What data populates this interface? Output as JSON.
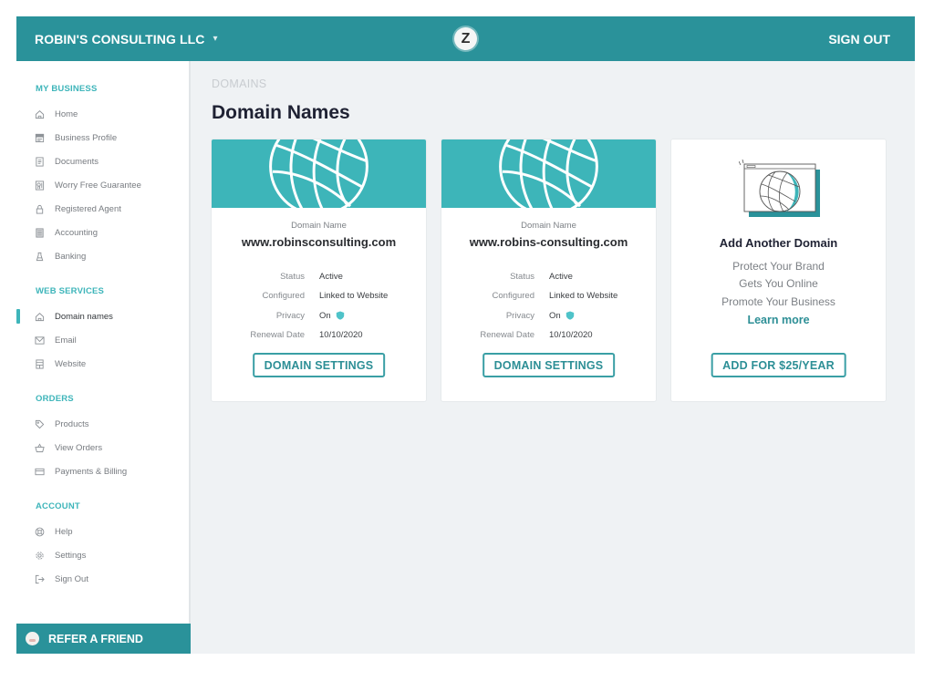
{
  "header": {
    "company": "ROBIN'S CONSULTING LLC",
    "logo_letter": "Z",
    "sign_out": "SIGN OUT"
  },
  "sidebar": {
    "sections": [
      {
        "title": "MY BUSINESS",
        "items": [
          {
            "label": "Home",
            "icon": "home-icon"
          },
          {
            "label": "Business Profile",
            "icon": "profile-icon"
          },
          {
            "label": "Documents",
            "icon": "document-icon"
          },
          {
            "label": "Worry Free Guarantee",
            "icon": "guarantee-icon"
          },
          {
            "label": "Registered Agent",
            "icon": "lock-icon"
          },
          {
            "label": "Accounting",
            "icon": "calculator-icon"
          },
          {
            "label": "Banking",
            "icon": "bank-icon"
          }
        ]
      },
      {
        "title": "WEB SERVICES",
        "items": [
          {
            "label": "Domain names",
            "icon": "home-icon",
            "active": true
          },
          {
            "label": "Email",
            "icon": "mail-icon"
          },
          {
            "label": "Website",
            "icon": "website-icon"
          }
        ]
      },
      {
        "title": "ORDERS",
        "items": [
          {
            "label": "Products",
            "icon": "tag-icon"
          },
          {
            "label": "View Orders",
            "icon": "basket-icon"
          },
          {
            "label": "Payments & Billing",
            "icon": "credit-card-icon"
          }
        ]
      },
      {
        "title": "ACCOUNT",
        "items": [
          {
            "label": "Help",
            "icon": "lifebuoy-icon"
          },
          {
            "label": "Settings",
            "icon": "gear-icon"
          },
          {
            "label": "Sign Out",
            "icon": "sign-out-icon"
          }
        ]
      }
    ],
    "refer_label": "REFER A FRIEND"
  },
  "main": {
    "breadcrumb": "DOMAINS",
    "title": "Domain Names",
    "domain_cards": [
      {
        "label": "Domain Name",
        "domain": "www.robinsconsulting.com",
        "fields": [
          {
            "key": "Status",
            "value": "Active"
          },
          {
            "key": "Configured",
            "value": "Linked to Website"
          },
          {
            "key": "Privacy",
            "value": "On",
            "icon": "shield-icon"
          },
          {
            "key": "Renewal Date",
            "value": "10/10/2020"
          }
        ],
        "button": "DOMAIN SETTINGS"
      },
      {
        "label": "Domain Name",
        "domain": "www.robins-consulting.com",
        "fields": [
          {
            "key": "Status",
            "value": "Active"
          },
          {
            "key": "Configured",
            "value": "Linked to Website"
          },
          {
            "key": "Privacy",
            "value": "On",
            "icon": "shield-icon"
          },
          {
            "key": "Renewal Date",
            "value": "10/10/2020"
          }
        ],
        "button": "DOMAIN SETTINGS"
      }
    ],
    "add_card": {
      "title": "Add Another Domain",
      "lines": [
        "Protect Your Brand",
        "Gets You Online",
        "Promote Your Business"
      ],
      "learn_more": "Learn more",
      "button": "ADD FOR $25/YEAR"
    }
  },
  "colors": {
    "brand": "#2a929a",
    "accent": "#3db5b9",
    "background": "#eff2f4"
  }
}
